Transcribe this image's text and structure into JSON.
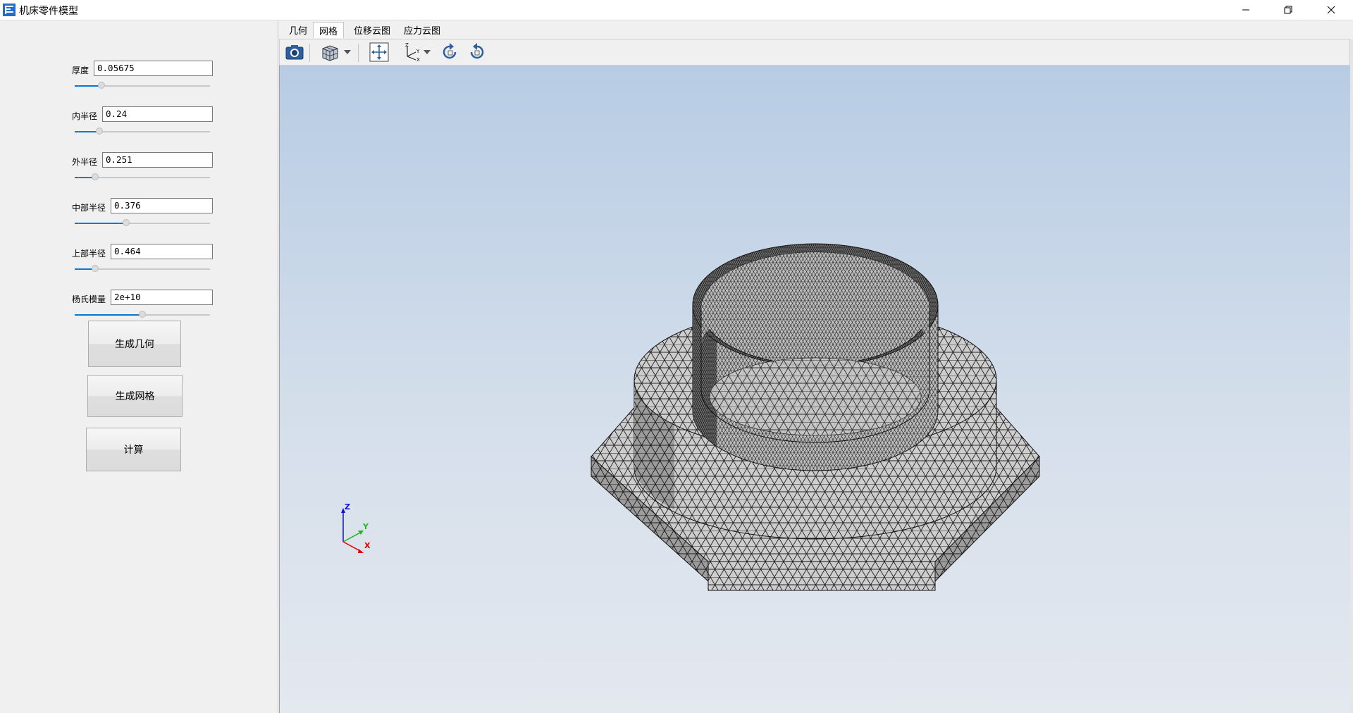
{
  "window": {
    "title": "机床零件模型"
  },
  "params": [
    {
      "label": "厚度",
      "value": "0.05675",
      "slider": 0.2
    },
    {
      "label": "内半径",
      "value": "0.24",
      "slider": 0.18
    },
    {
      "label": "外半径",
      "value": "0.251",
      "slider": 0.15
    },
    {
      "label": "中部半径",
      "value": "0.376",
      "slider": 0.38
    },
    {
      "label": "上部半径",
      "value": "0.464",
      "slider": 0.15
    },
    {
      "label": "杨氏模量",
      "value": "2e+10",
      "slider": 0.5
    }
  ],
  "buttons": {
    "geometry": "生成几何",
    "mesh": "生成网格",
    "compute": "计算"
  },
  "tabs": [
    "几何",
    "网格",
    "位移云图",
    "应力云图"
  ],
  "active_tab": "网格",
  "toolbar": {
    "icons": [
      "camera-icon",
      "cube-view-icon",
      "dropdown-arrow-icon",
      "fit-view-icon",
      "axes-icon",
      "dropdown-arrow-icon",
      "rotate-left-icon",
      "rotate-right-icon"
    ]
  },
  "axes": {
    "z": "Z",
    "y": "Y",
    "x": "X"
  },
  "colors": {
    "accent": "#0078d7",
    "viewport_top": "#b7cce4",
    "viewport_bottom": "#e4e8ef",
    "mesh_face": "#c6c6c6",
    "mesh_edge": "#1e1e1e",
    "axis_x": "#e00000",
    "axis_y": "#22b422",
    "axis_z": "#1010d0"
  }
}
